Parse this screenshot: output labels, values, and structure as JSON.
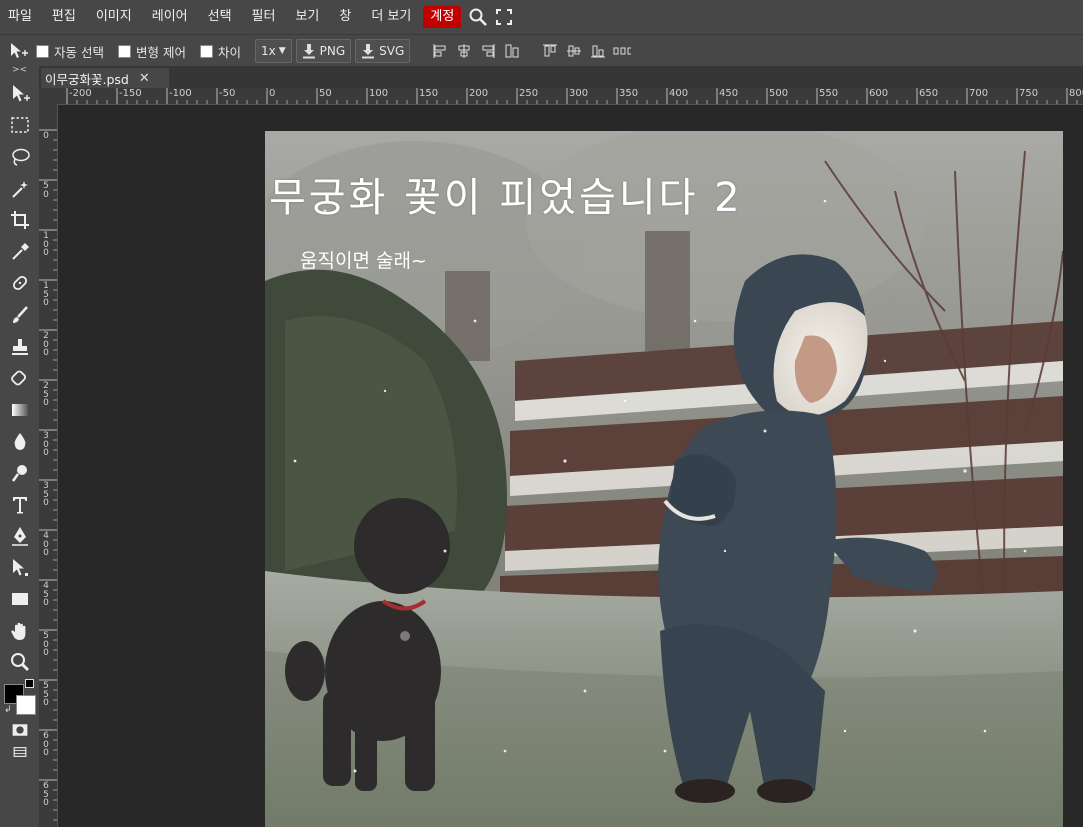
{
  "menubar": {
    "items": [
      "파일",
      "편집",
      "이미지",
      "레이어",
      "선택",
      "필터",
      "보기",
      "창",
      "더 보기"
    ],
    "account_label": "계정",
    "search_icon": "search-icon",
    "fullscreen_icon": "fullscreen-icon"
  },
  "options": {
    "auto_select_label": "자동 선택",
    "transform_label": "변형 제어",
    "distance_label": "차이",
    "zoom_value": "1x",
    "export_png_label": "PNG",
    "export_svg_label": "SVG"
  },
  "tab": {
    "filename": "이무궁화꽃.psd",
    "close_glyph": "✕"
  },
  "ruler": {
    "top_labels": [
      "-200",
      "-150",
      "-100",
      "-50",
      "0",
      "50",
      "100",
      "150",
      "200",
      "250",
      "300",
      "350",
      "400",
      "450",
      "500",
      "550",
      "600",
      "650",
      "700",
      "750",
      "800"
    ],
    "left_labels": [
      "0",
      "5 0",
      "1 0 0",
      "1 5 0",
      "2 0 0",
      "2 5 0",
      "3 0 0",
      "3 5 0",
      "4 0 0",
      "4 5 0",
      "5 0 0",
      "5 5 0",
      "6 0 0",
      "6 5 0"
    ]
  },
  "canvas": {
    "title": "무궁화 꽃이 피었습니다 2",
    "subtitle": "움직이면 술래~"
  },
  "colors": {
    "menubar_bg": "#474747",
    "account_bg": "#c00000",
    "workspace_bg": "#282828",
    "foreground_swatch": "#000000",
    "background_swatch": "#ffffff"
  },
  "tools": [
    "move-icon",
    "marquee-icon",
    "lasso-icon",
    "magic-wand-icon",
    "crop-icon",
    "eyedropper-icon",
    "healing-icon",
    "brush-icon",
    "stamp-icon",
    "eraser-icon",
    "gradient-icon",
    "blur-icon",
    "dodge-icon",
    "type-icon",
    "pen-icon",
    "path-select-icon",
    "rectangle-icon",
    "hand-icon",
    "zoom-icon"
  ]
}
